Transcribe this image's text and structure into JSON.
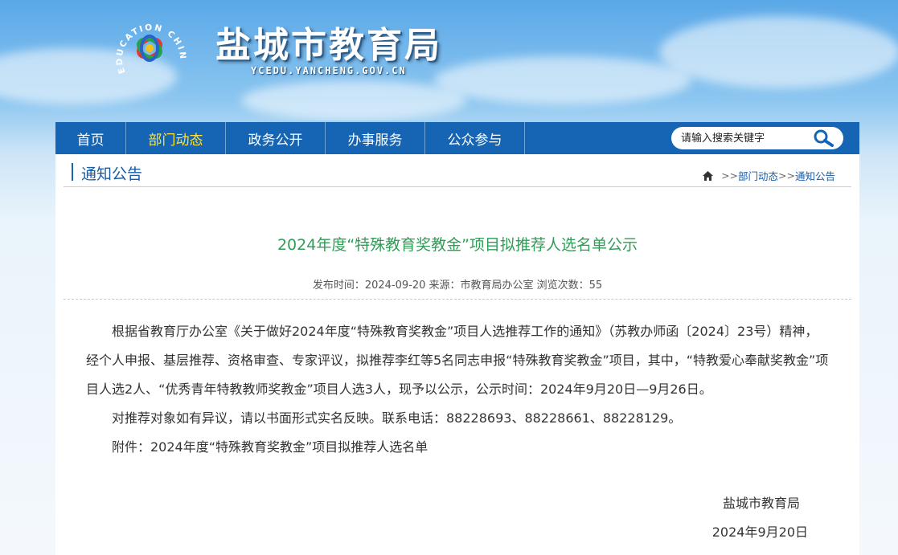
{
  "site": {
    "title": "盐城市教育局",
    "domain": "YCEDU.YANCHENG.GOV.CN",
    "logo_ring_text": "EDUCATION CHINA YANCHENG"
  },
  "nav": {
    "items": [
      {
        "label": "首页",
        "active": false
      },
      {
        "label": "部门动态",
        "active": true
      },
      {
        "label": "政务公开",
        "active": false
      },
      {
        "label": "办事服务",
        "active": false
      },
      {
        "label": "公众参与",
        "active": false
      }
    ],
    "search_placeholder": "请输入搜索关键字"
  },
  "section": {
    "title": "通知公告",
    "breadcrumb": {
      "sep": ">>",
      "crumbs": [
        "部门动态",
        "通知公告"
      ]
    }
  },
  "article": {
    "title": "2024年度“特殊教育奖教金”项目拟推荐人选名单公示",
    "meta": "发布时间：2024-09-20 来源：市教育局办公室 浏览次数：55",
    "paragraphs": [
      "根据省教育厅办公室《关于做好2024年度“特殊教育奖教金”项目人选推荐工作的通知》（苏教办师函〔2024〕23号）精神，经个人申报、基层推荐、资格审查、专家评议，拟推荐李红等5名同志申报“特殊教育奖教金”项目，其中，“特教爱心奉献奖教金”项目人选2人、“优秀青年特教教师奖教金”项目人选3人，现予以公示，公示时间：2024年9月20日—9月26日。",
      "对推荐对象如有异议，请以书面形式实名反映。联系电话：88228693、88228661、88228129。",
      "附件：2024年度“特殊教育奖教金”项目拟推荐人选名单"
    ],
    "signer": "盐城市教育局",
    "sign_date": "2024年9月20日"
  },
  "colors": {
    "nav_bg": "#1565b4",
    "nav_active": "#ffe23b",
    "title_green": "#2e9e56",
    "link_blue": "#1a5ba6"
  }
}
